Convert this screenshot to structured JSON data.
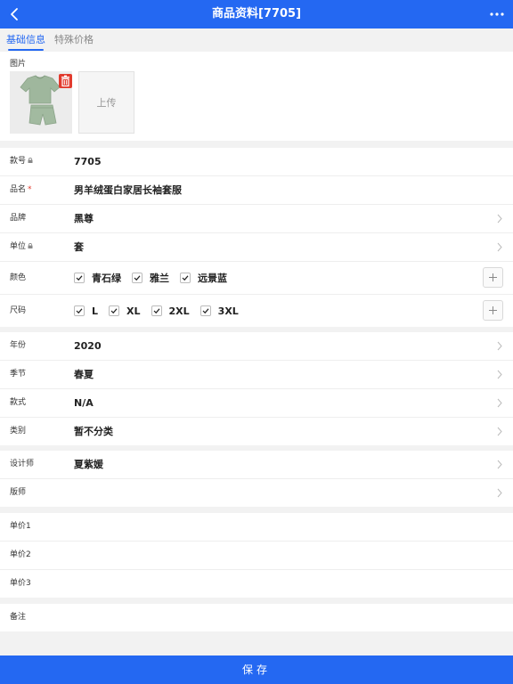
{
  "header": {
    "title": "商品资料[7705]"
  },
  "tabs": [
    {
      "label": "基础信息",
      "active": true
    },
    {
      "label": "特殊价格",
      "active": false
    }
  ],
  "images": {
    "label": "图片",
    "upload_label": "上传"
  },
  "basic": {
    "style_no": {
      "label": "款号",
      "value": "7705"
    },
    "name": {
      "label": "品名",
      "required_mark": "*",
      "value": "男羊绒蛋白家居长袖套服"
    },
    "brand": {
      "label": "品牌",
      "value": "黑尊"
    },
    "unit": {
      "label": "单位",
      "value": "套"
    },
    "color": {
      "label": "颜色",
      "options": [
        "青石绿",
        "雅兰",
        "远景蓝"
      ]
    },
    "size": {
      "label": "尺码",
      "options": [
        "L",
        "XL",
        "2XL",
        "3XL"
      ]
    }
  },
  "attrs": {
    "year": {
      "label": "年份",
      "value": "2020"
    },
    "season": {
      "label": "季节",
      "value": "春夏"
    },
    "style": {
      "label": "款式",
      "value": "N/A"
    },
    "category": {
      "label": "类别",
      "value": "暂不分类"
    }
  },
  "people": {
    "designer": {
      "label": "设计师",
      "value": "夏紫媛"
    },
    "patternmaker": {
      "label": "版师",
      "value": ""
    }
  },
  "prices": {
    "price1": {
      "label": "单价1"
    },
    "price2": {
      "label": "单价2"
    },
    "price3": {
      "label": "单价3"
    }
  },
  "remark": {
    "label": "备注"
  },
  "footer": {
    "save_label": "保存"
  },
  "colors": {
    "accent": "#2468f2",
    "delete": "#e23b2e",
    "garment": "#9fb79d"
  }
}
